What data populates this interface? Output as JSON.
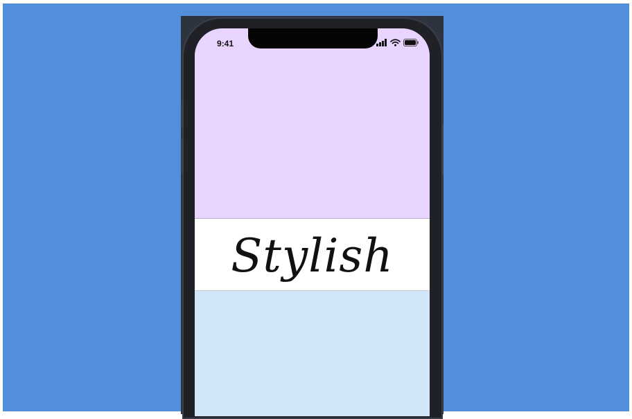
{
  "status_bar": {
    "time": "9:41",
    "icons": [
      "cellular-signal-icon",
      "wifi-icon",
      "battery-icon"
    ]
  },
  "main": {
    "label": "Stylish"
  },
  "colors": {
    "background": "#528fdb",
    "phone_frame": "#1f2126",
    "top_panel": "#e9d3ff",
    "middle_panel": "#ffffff",
    "bottom_panel": "#d2e6fa",
    "text": "#111111"
  }
}
